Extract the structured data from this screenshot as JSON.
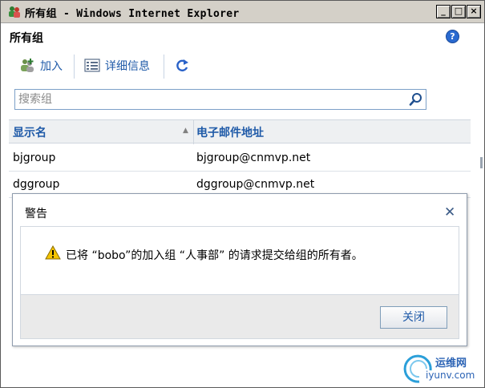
{
  "window": {
    "title": "所有组 - Windows Internet Explorer",
    "controls": [
      "_",
      "□",
      "×"
    ]
  },
  "page": {
    "title": "所有组",
    "help_icon": "help-icon"
  },
  "toolbar": {
    "add_label": "加入",
    "details_label": "详细信息",
    "refresh_icon": "refresh-icon"
  },
  "search": {
    "placeholder": "搜索组"
  },
  "table": {
    "columns": [
      "显示名",
      "电子邮件地址"
    ],
    "rows": [
      {
        "name": "bjgroup",
        "email": "bjgroup@cnmvp.net"
      },
      {
        "name": "dggroup",
        "email": "dggroup@cnmvp.net"
      }
    ]
  },
  "dialog": {
    "title": "警告",
    "message": "已将 “bobo”的加入组 “人事部” 的请求提交给组的所有者。",
    "ok_label": "关闭"
  },
  "watermark": {
    "top": "运维网",
    "bottom": "iyunv.com"
  },
  "colors": {
    "accent": "#1f5aa8",
    "titlebar": "#d4d0c8",
    "header_bg": "#eef0f2",
    "footer_bg": "#eaeaea"
  }
}
